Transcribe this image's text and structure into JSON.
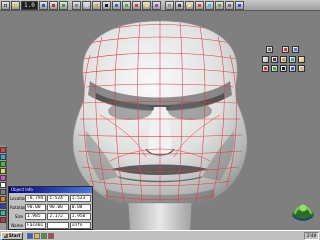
{
  "toolbar": {
    "scale_readout": "1.0",
    "left_tools": [
      "new-icon",
      "open-icon",
      "save-icon",
      "undo-icon",
      "redo-icon",
      "cut-icon",
      "copy-icon",
      "paste-icon",
      "select-icon",
      "move-icon",
      "rotate-icon",
      "scale-icon",
      "extrude-icon",
      "snap-icon"
    ],
    "right_tools": [
      "grid-icon",
      "camera-icon",
      "light-icon",
      "render-icon",
      "material-icon",
      "texture-icon",
      "settings-icon",
      "help-icon"
    ]
  },
  "colors": {
    "background": "#7f7f7f",
    "wireframe": "#e23a3a",
    "panel_title": "#00007a"
  },
  "transform_panel": {
    "title": "Object Info",
    "rows": [
      {
        "label": "Location",
        "values": [
          "-0.794",
          "1.524",
          "1.523"
        ]
      },
      {
        "label": "Rotation",
        "values": [
          "90.00",
          "90.00",
          "0.00"
        ]
      },
      {
        "label": "Size",
        "values": [
          "1.985",
          "2.172",
          "1.950"
        ]
      },
      {
        "label": "Name",
        "values": [
          "Face01",
          "",
          "Info"
        ]
      }
    ]
  },
  "taskbar": {
    "start_label": "Start",
    "clock": "2:48"
  }
}
